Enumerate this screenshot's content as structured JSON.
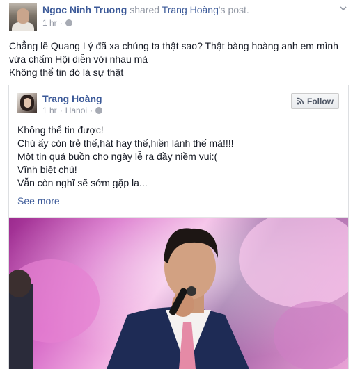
{
  "post": {
    "author": "Ngoc Ninh Truong",
    "action": "shared",
    "shared_from": "Trang Hoàng",
    "shared_suffix": "'s post.",
    "time": "1 hr",
    "privacy_icon": "globe-icon",
    "menu_icon": "chevron-down-icon",
    "text_lines": [
      "Chẳng lẽ Quang Lý đã xa chúng ta thật sao? Thật bàng hoàng anh em mình",
      "vừa chấm Hội diễn với nhau mà",
      "Không thể tin đó là sự thật"
    ]
  },
  "shared": {
    "author": "Trang Hoàng",
    "time": "1 hr",
    "location": "Hanoi",
    "follow_label": "Follow",
    "follow_icon": "rss-icon",
    "text_lines": [
      "Không thể tin được!",
      "Chú ấy còn trẻ thế,hát hay thế,hiền lành thế mà!!!!",
      "Một tin quá buồn cho ngày lễ ra đầy niềm vui:(",
      "Vĩnh biệt chú!",
      "Vẫn còn nghĩ sẽ sớm gặp la..."
    ],
    "see_more": "See more"
  },
  "colors": {
    "link": "#3b5998",
    "muted": "#9197a3",
    "text": "#141823",
    "border": "#dddfe2"
  }
}
